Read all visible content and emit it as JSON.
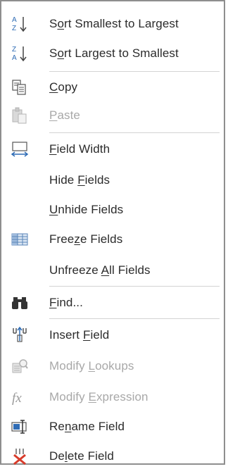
{
  "menu": {
    "items": [
      {
        "id": "sort-asc",
        "pre": "S",
        "acc": "o",
        "post": "rt Smallest to Largest",
        "icon": "sort-ascending-icon",
        "disabled": false
      },
      {
        "id": "sort-desc",
        "pre": "S",
        "acc": "o",
        "post": "rt Largest to Smallest",
        "icon": "sort-descending-icon",
        "disabled": false
      },
      {
        "id": "copy",
        "pre": "",
        "acc": "C",
        "post": "opy",
        "icon": "copy-icon",
        "disabled": false
      },
      {
        "id": "paste",
        "pre": "",
        "acc": "P",
        "post": "aste",
        "icon": "paste-icon",
        "disabled": true
      },
      {
        "id": "field-width",
        "pre": "",
        "acc": "F",
        "post": "ield Width",
        "icon": "field-width-icon",
        "disabled": false
      },
      {
        "id": "hide-fields",
        "pre": "Hide ",
        "acc": "F",
        "post": "ields",
        "icon": "",
        "disabled": false
      },
      {
        "id": "unhide-fields",
        "pre": "",
        "acc": "U",
        "post": "nhide Fields",
        "icon": "",
        "disabled": false
      },
      {
        "id": "freeze-fields",
        "pre": "Free",
        "acc": "z",
        "post": "e Fields",
        "icon": "freeze-grid-icon",
        "disabled": false
      },
      {
        "id": "unfreeze-all-fields",
        "pre": "Unfreeze ",
        "acc": "A",
        "post": "ll Fields",
        "icon": "",
        "disabled": false
      },
      {
        "id": "find",
        "pre": "",
        "acc": "F",
        "post": "ind...",
        "icon": "binoculars-icon",
        "disabled": false
      },
      {
        "id": "insert-field",
        "pre": "Insert ",
        "acc": "F",
        "post": "ield",
        "icon": "insert-field-icon",
        "disabled": false
      },
      {
        "id": "modify-lookups",
        "pre": "Modify ",
        "acc": "L",
        "post": "ookups",
        "icon": "modify-lookups-icon",
        "disabled": true
      },
      {
        "id": "modify-expression",
        "pre": "Modify ",
        "acc": "E",
        "post": "xpression",
        "icon": "fx-icon",
        "disabled": true
      },
      {
        "id": "rename-field",
        "pre": "Re",
        "acc": "n",
        "post": "ame Field",
        "icon": "rename-field-icon",
        "disabled": false
      },
      {
        "id": "delete-field",
        "pre": "De",
        "acc": "l",
        "post": "ete Field",
        "icon": "delete-field-icon",
        "disabled": false
      }
    ]
  },
  "icons": {
    "fx_glyph": "fx",
    "sort_asc_top": "A",
    "sort_asc_bottom": "Z",
    "sort_desc_top": "Z",
    "sort_desc_bottom": "A"
  },
  "colors": {
    "text": "#2b2b2b",
    "disabled_text": "#a8a8a8",
    "icon_blue": "#2f6cb5",
    "delete_red": "#d83b2a",
    "border": "#8e8e8e",
    "separator": "#d4d4d4"
  }
}
